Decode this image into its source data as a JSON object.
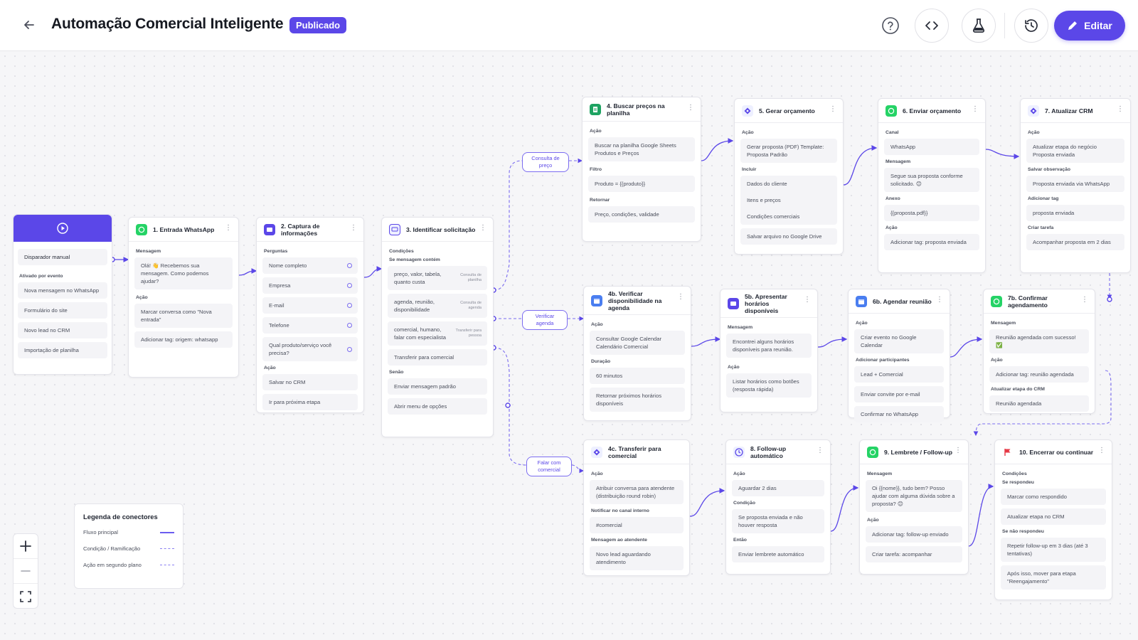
{
  "header": {
    "title": "Automação Comercial Inteligente",
    "status_badge": "Publicado",
    "edit_label": "Editar"
  },
  "icons": {
    "back": "arrow-left-icon",
    "help": "help-circle-icon",
    "code": "code-icon",
    "test": "flask-icon",
    "history": "history-icon",
    "edit": "pencil-icon"
  },
  "colors": {
    "accent": "#5b47e8",
    "whatsapp": "#25d366",
    "sheets": "#1ea362",
    "calendar": "#4a7ef0",
    "flag": "#e63946"
  },
  "trigger": {
    "label": "Disparador manual",
    "events_title": "Ativado por evento",
    "events": [
      "Nova mensagem no WhatsApp",
      "Formulário do site",
      "Novo lead no CRM",
      "Importação de planilha"
    ]
  },
  "node1": {
    "title": "1. Entrada WhatsApp",
    "msg_label": "Mensagem",
    "msg": "Olá! 👋 Recebemos sua mensagem. Como podemos ajudar?",
    "action_label": "Ação",
    "a1": "Marcar conversa como \"Nova entrada\"",
    "a2": "Adicionar tag: origem: whatsapp"
  },
  "node2": {
    "title": "2. Captura de informações",
    "q_label": "Perguntas",
    "q": [
      "Nome completo",
      "Empresa",
      "E-mail",
      "Telefone",
      "Qual produto/serviço você precisa?"
    ],
    "action_label": "Ação",
    "a1": "Salvar no CRM",
    "a2": "Ir para próxima etapa"
  },
  "node3": {
    "title": "3. Identificar solicitação",
    "cond_label": "Condições",
    "contains_label": "Se mensagem contém",
    "c1": "preço, valor, tabela, quanto custa",
    "c1_tag": "Consulta de planilha",
    "c2": "agenda, reunião, disponibilidade",
    "c2_tag": "Consulta de agenda",
    "c3": "comercial, humano, falar com especialista",
    "c3_tag": "Transferir para pessoa",
    "c4": "Transferir para comercial",
    "else_label": "Senão",
    "e1": "Enviar mensagem padrão",
    "e2": "Abrir menu de opções"
  },
  "chips": {
    "price": "Consulta de preço",
    "agenda": "Verificar agenda",
    "sales": "Falar com comercial"
  },
  "node4": {
    "title": "4. Buscar preços na planilha",
    "action_label": "Ação",
    "action": "Buscar na planilha Google Sheets Produtos e Preços",
    "filter_label": "Filtro",
    "filter": "Produto = {{produto}}",
    "return_label": "Retornar",
    "return": "Preço, condições, validade"
  },
  "node5": {
    "title": "5. Gerar orçamento",
    "action_label": "Ação",
    "action": "Gerar proposta (PDF) Template: Proposta Padrão",
    "include_label": "Incluir",
    "inc": [
      "Dados do cliente",
      "Itens e preços",
      "Condições comerciais"
    ],
    "save": "Salvar arquivo no Google Drive"
  },
  "node6": {
    "title": "6. Enviar orçamento",
    "channel_label": "Canal",
    "channel": "WhatsApp",
    "msg_label": "Mensagem",
    "msg": "Segue sua proposta conforme solicitado. 😊",
    "attach_label": "Anexo",
    "attach": "{{proposta.pdf}}",
    "action_label": "Ação",
    "action": "Adicionar tag: proposta enviada"
  },
  "node7": {
    "title": "7. Atualizar CRM",
    "action_label": "Ação",
    "action": "Atualizar etapa do negócio Proposta enviada",
    "obs_label": "Salvar observação",
    "obs": "Proposta enviada via WhatsApp",
    "tag_label": "Adicionar tag",
    "tag": "proposta enviada",
    "task_label": "Criar tarefa",
    "task": "Acompanhar proposta em 2 dias"
  },
  "node4b": {
    "title": "4b. Verificar disponibilidade na agenda",
    "action_label": "Ação",
    "action": "Consultar Google Calendar Calendário Comercial",
    "dur_label": "Duração",
    "dur": "60 minutos",
    "ret": "Retornar próximos horários disponíveis"
  },
  "node5b": {
    "title": "5b. Apresentar horários disponíveis",
    "msg_label": "Mensagem",
    "msg": "Encontrei alguns horários disponíveis para reunião.",
    "action_label": "Ação",
    "action": "Listar horários como botões (resposta rápida)"
  },
  "node6b": {
    "title": "6b. Agendar reunião",
    "action_label": "Ação",
    "action": "Criar evento no Google Calendar",
    "part_label": "Adicionar participantes",
    "part": "Lead + Comercial",
    "invite": "Enviar convite por e-mail",
    "confirm": "Confirmar no WhatsApp"
  },
  "node7b": {
    "title": "7b. Confirmar agendamento",
    "msg_label": "Mensagem",
    "msg": "Reunião agendada com sucesso! ✅",
    "action_label": "Ação",
    "action": "Adicionar tag: reunião agendada",
    "stage_label": "Atualizar etapa do CRM",
    "stage": "Reunião agendada"
  },
  "node4c": {
    "title": "4c. Transferir para comercial",
    "action_label": "Ação",
    "action": "Atribuir conversa para atendente (distribuição round robin)",
    "notify_label": "Notificar no canal interno",
    "notify": "#comercial",
    "msg_label": "Mensagem ao atendente",
    "msg": "Novo lead aguardando atendimento"
  },
  "node8": {
    "title": "8. Follow-up automático",
    "action_label": "Ação",
    "action": "Aguardar 2 dias",
    "cond_label": "Condição",
    "cond": "Se proposta enviada e não houver resposta",
    "then_label": "Então",
    "then": "Enviar lembrete automático"
  },
  "node9": {
    "title": "9. Lembrete / Follow-up",
    "msg_label": "Mensagem",
    "msg": "Oi {{nome}}, tudo bem? Posso ajudar com alguma dúvida sobre a proposta? 😊",
    "action_label": "Ação",
    "a1": "Adicionar tag: follow-up enviado",
    "a2": "Criar tarefa: acompanhar"
  },
  "node10": {
    "title": "10. Encerrar ou continuar",
    "cond_label": "Condições",
    "yes_label": "Se respondeu",
    "y1": "Marcar como respondido",
    "y2": "Atualizar etapa no CRM",
    "no_label": "Se não respondeu",
    "n1": "Repetir follow-up em 3 dias (até 3 tentativas)",
    "n2": "Após isso, mover para etapa \"Reengajamento\""
  },
  "legend": {
    "title": "Legenda de conectores",
    "items": [
      "Fluxo principal",
      "Condição / Ramificação",
      "Ação em segundo plano"
    ]
  }
}
